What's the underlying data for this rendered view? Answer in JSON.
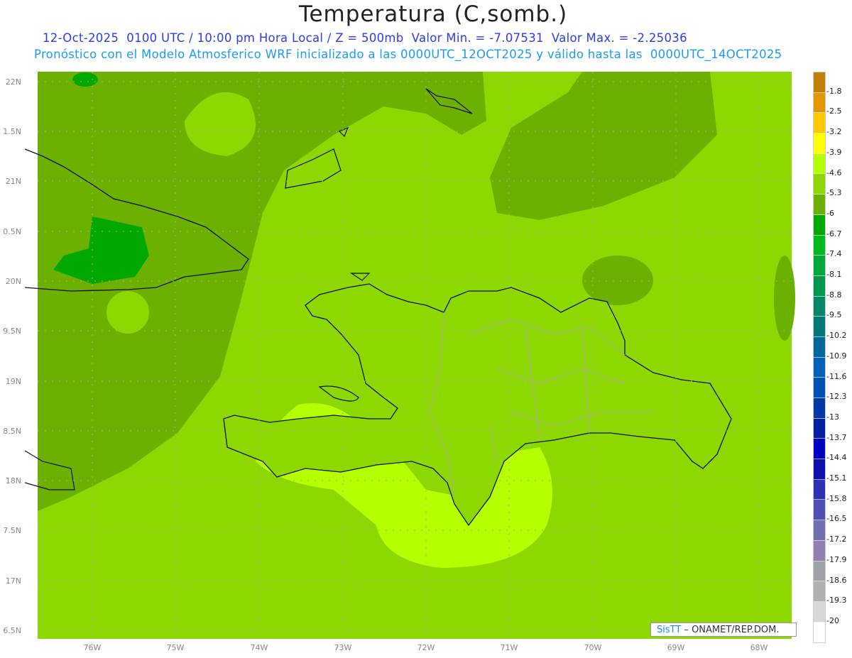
{
  "title": "Temperatura (C,somb.)",
  "subtitle_line1": "12-Oct-2025  0100 UTC / 10:00 pm Hora Local / Z = 500mb  Valor Min. = -7.07531  Valor Max. = -2.25036",
  "subtitle_line2": "Pronóstico con el Modelo Atmosferico WRF inicializado a las 0000UTC_12OCT2025 y válido hasta las  0000UTC_14OCT2025",
  "x_ticks": [
    "76W",
    "75W",
    "74W",
    "73W",
    "72W",
    "71W",
    "70W",
    "69W",
    "68W"
  ],
  "y_ticks": [
    "22N",
    "1.5N",
    "21N",
    "0.5N",
    "20N",
    "9.5N",
    "19N",
    "8.5N",
    "18N",
    "7.5N",
    "17N",
    "6.5N"
  ],
  "colorbar": {
    "labels": [
      "-1.8",
      "-2.5",
      "-3.2",
      "-3.9",
      "-4.6",
      "-5.3",
      "-6",
      "-6.7",
      "-7.4",
      "-8.1",
      "-8.8",
      "-9.5",
      "-10.2",
      "-10.9",
      "-11.6",
      "-12.3",
      "-13",
      "-13.7",
      "-14.4",
      "-15.1",
      "-15.8",
      "-16.5",
      "-17.2",
      "-17.9",
      "-18.6",
      "-19.3",
      "-20"
    ],
    "colors": [
      "#c08000",
      "#e09a00",
      "#ffc800",
      "#ffff00",
      "#b4ff00",
      "#8cd800",
      "#6cb000",
      "#00a800",
      "#00b820",
      "#00a83c",
      "#009850",
      "#008868",
      "#007878",
      "#006898",
      "#0060b8",
      "#0050b0",
      "#0038a8",
      "#0020a0",
      "#0000c0",
      "#1010b0",
      "#3030b0",
      "#5050b0",
      "#7070b0",
      "#9080b0",
      "#a0a0a8",
      "#b0b0b0",
      "#d8d8d8",
      "#ffffff"
    ]
  },
  "logo": {
    "brand": "SisTT",
    "text": "– ONAMET/REP.DOM."
  }
}
